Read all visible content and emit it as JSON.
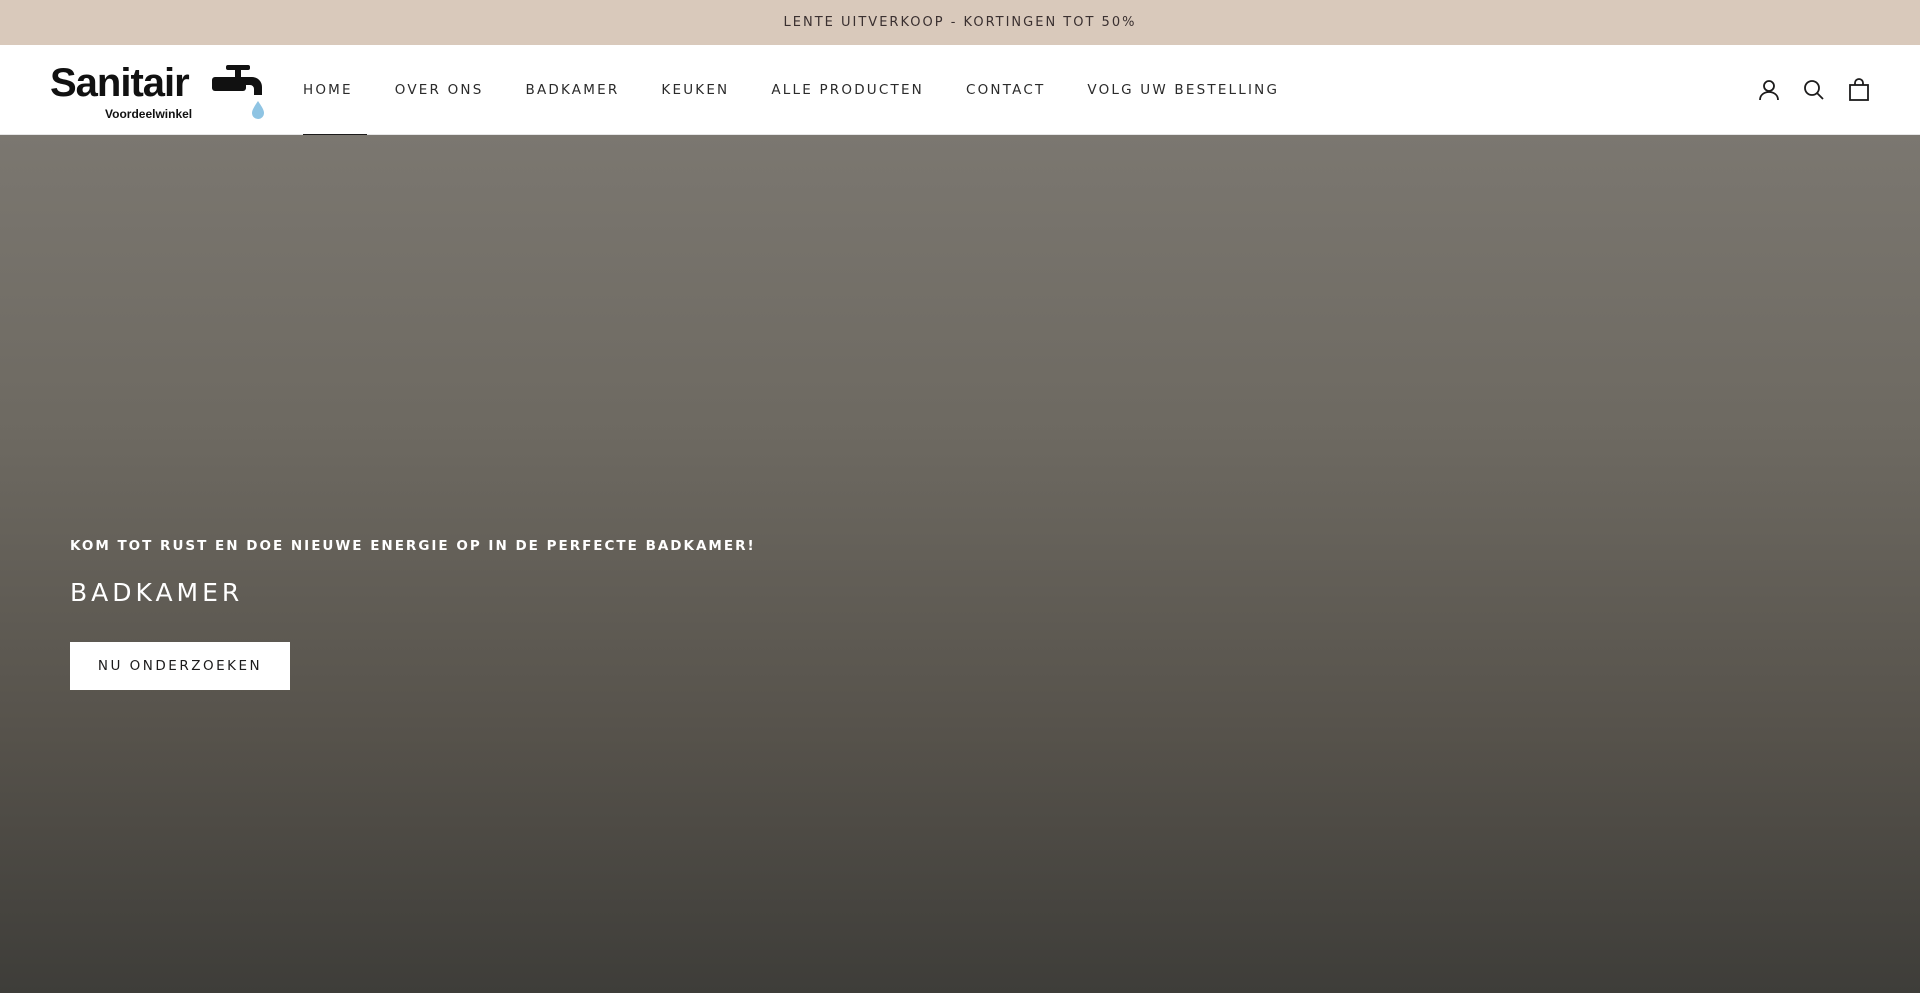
{
  "announcement": {
    "text": "LENTE UITVERKOOP - KORTINGEN TOT 50%"
  },
  "logo": {
    "name": "Sanitair",
    "sub": "Voordeelwinkel"
  },
  "nav": {
    "items": [
      {
        "label": "HOME",
        "active": true
      },
      {
        "label": "OVER ONS"
      },
      {
        "label": "BADKAMER"
      },
      {
        "label": "KEUKEN"
      },
      {
        "label": "ALLE PRODUCTEN"
      },
      {
        "label": "CONTACT"
      },
      {
        "label": "VOLG UW BESTELLING"
      }
    ]
  },
  "header_icons": [
    "account-icon",
    "search-icon",
    "cart-icon"
  ],
  "hero": {
    "subtitle": "KOM TOT RUST EN DOE NIEUWE ENERGIE OP IN DE PERFECTE BADKAMER!",
    "title": "BADKAMER",
    "button_label": "NU ONDERZOEKEN"
  },
  "colors": {
    "announcement_bg": "#d9c9bb",
    "hero_top": "#7b7770",
    "hero_bottom": "#3e3d39",
    "water_drop": "#8fc4e3"
  }
}
